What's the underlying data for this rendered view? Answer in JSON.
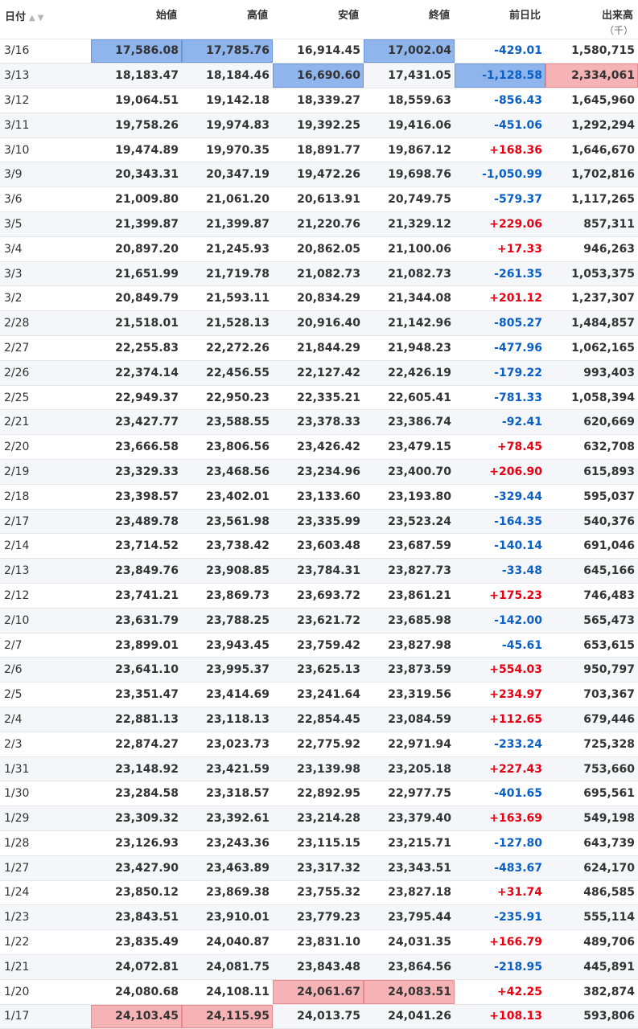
{
  "columns": {
    "date": "日付",
    "open": "始値",
    "high": "高値",
    "low": "安値",
    "close": "終値",
    "change": "前日比",
    "volume": "出来高",
    "volume_unit": "（千）"
  },
  "icons": {
    "sort": "sort-up-down-icon"
  },
  "colors": {
    "positive": "#e60012",
    "negative": "#0a5fc4",
    "highlight_blue": "#8fb5ec",
    "highlight_red": "#f5b3b5"
  },
  "rows": [
    {
      "date": "3/16",
      "open": "17,586.08",
      "high": "17,785.76",
      "low": "16,914.45",
      "close": "17,002.04",
      "change": "-429.01",
      "volume": "1,580,715",
      "hl": {
        "open": "blue",
        "high": "blue",
        "close": "blue"
      }
    },
    {
      "date": "3/13",
      "open": "18,183.47",
      "high": "18,184.46",
      "low": "16,690.60",
      "close": "17,431.05",
      "change": "-1,128.58",
      "volume": "2,334,061",
      "hl": {
        "low": "blue",
        "change": "blue",
        "volume": "red"
      }
    },
    {
      "date": "3/12",
      "open": "19,064.51",
      "high": "19,142.18",
      "low": "18,339.27",
      "close": "18,559.63",
      "change": "-856.43",
      "volume": "1,645,960"
    },
    {
      "date": "3/11",
      "open": "19,758.26",
      "high": "19,974.83",
      "low": "19,392.25",
      "close": "19,416.06",
      "change": "-451.06",
      "volume": "1,292,294"
    },
    {
      "date": "3/10",
      "open": "19,474.89",
      "high": "19,970.35",
      "low": "18,891.77",
      "close": "19,867.12",
      "change": "+168.36",
      "volume": "1,646,670"
    },
    {
      "date": "3/9",
      "open": "20,343.31",
      "high": "20,347.19",
      "low": "19,472.26",
      "close": "19,698.76",
      "change": "-1,050.99",
      "volume": "1,702,816"
    },
    {
      "date": "3/6",
      "open": "21,009.80",
      "high": "21,061.20",
      "low": "20,613.91",
      "close": "20,749.75",
      "change": "-579.37",
      "volume": "1,117,265"
    },
    {
      "date": "3/5",
      "open": "21,399.87",
      "high": "21,399.87",
      "low": "21,220.76",
      "close": "21,329.12",
      "change": "+229.06",
      "volume": "857,311"
    },
    {
      "date": "3/4",
      "open": "20,897.20",
      "high": "21,245.93",
      "low": "20,862.05",
      "close": "21,100.06",
      "change": "+17.33",
      "volume": "946,263"
    },
    {
      "date": "3/3",
      "open": "21,651.99",
      "high": "21,719.78",
      "low": "21,082.73",
      "close": "21,082.73",
      "change": "-261.35",
      "volume": "1,053,375"
    },
    {
      "date": "3/2",
      "open": "20,849.79",
      "high": "21,593.11",
      "low": "20,834.29",
      "close": "21,344.08",
      "change": "+201.12",
      "volume": "1,237,307"
    },
    {
      "date": "2/28",
      "open": "21,518.01",
      "high": "21,528.13",
      "low": "20,916.40",
      "close": "21,142.96",
      "change": "-805.27",
      "volume": "1,484,857"
    },
    {
      "date": "2/27",
      "open": "22,255.83",
      "high": "22,272.26",
      "low": "21,844.29",
      "close": "21,948.23",
      "change": "-477.96",
      "volume": "1,062,165"
    },
    {
      "date": "2/26",
      "open": "22,374.14",
      "high": "22,456.55",
      "low": "22,127.42",
      "close": "22,426.19",
      "change": "-179.22",
      "volume": "993,403"
    },
    {
      "date": "2/25",
      "open": "22,949.37",
      "high": "22,950.23",
      "low": "22,335.21",
      "close": "22,605.41",
      "change": "-781.33",
      "volume": "1,058,394"
    },
    {
      "date": "2/21",
      "open": "23,427.77",
      "high": "23,588.55",
      "low": "23,378.33",
      "close": "23,386.74",
      "change": "-92.41",
      "volume": "620,669"
    },
    {
      "date": "2/20",
      "open": "23,666.58",
      "high": "23,806.56",
      "low": "23,426.42",
      "close": "23,479.15",
      "change": "+78.45",
      "volume": "632,708"
    },
    {
      "date": "2/19",
      "open": "23,329.33",
      "high": "23,468.56",
      "low": "23,234.96",
      "close": "23,400.70",
      "change": "+206.90",
      "volume": "615,893"
    },
    {
      "date": "2/18",
      "open": "23,398.57",
      "high": "23,402.01",
      "low": "23,133.60",
      "close": "23,193.80",
      "change": "-329.44",
      "volume": "595,037"
    },
    {
      "date": "2/17",
      "open": "23,489.78",
      "high": "23,561.98",
      "low": "23,335.99",
      "close": "23,523.24",
      "change": "-164.35",
      "volume": "540,376"
    },
    {
      "date": "2/14",
      "open": "23,714.52",
      "high": "23,738.42",
      "low": "23,603.48",
      "close": "23,687.59",
      "change": "-140.14",
      "volume": "691,046"
    },
    {
      "date": "2/13",
      "open": "23,849.76",
      "high": "23,908.85",
      "low": "23,784.31",
      "close": "23,827.73",
      "change": "-33.48",
      "volume": "645,166"
    },
    {
      "date": "2/12",
      "open": "23,741.21",
      "high": "23,869.73",
      "low": "23,693.72",
      "close": "23,861.21",
      "change": "+175.23",
      "volume": "746,483"
    },
    {
      "date": "2/10",
      "open": "23,631.79",
      "high": "23,788.25",
      "low": "23,621.72",
      "close": "23,685.98",
      "change": "-142.00",
      "volume": "565,473"
    },
    {
      "date": "2/7",
      "open": "23,899.01",
      "high": "23,943.45",
      "low": "23,759.42",
      "close": "23,827.98",
      "change": "-45.61",
      "volume": "653,615"
    },
    {
      "date": "2/6",
      "open": "23,641.10",
      "high": "23,995.37",
      "low": "23,625.13",
      "close": "23,873.59",
      "change": "+554.03",
      "volume": "950,797"
    },
    {
      "date": "2/5",
      "open": "23,351.47",
      "high": "23,414.69",
      "low": "23,241.64",
      "close": "23,319.56",
      "change": "+234.97",
      "volume": "703,367"
    },
    {
      "date": "2/4",
      "open": "22,881.13",
      "high": "23,118.13",
      "low": "22,854.45",
      "close": "23,084.59",
      "change": "+112.65",
      "volume": "679,446"
    },
    {
      "date": "2/3",
      "open": "22,874.27",
      "high": "23,023.73",
      "low": "22,775.92",
      "close": "22,971.94",
      "change": "-233.24",
      "volume": "725,328"
    },
    {
      "date": "1/31",
      "open": "23,148.92",
      "high": "23,421.59",
      "low": "23,139.98",
      "close": "23,205.18",
      "change": "+227.43",
      "volume": "753,660"
    },
    {
      "date": "1/30",
      "open": "23,284.58",
      "high": "23,318.57",
      "low": "22,892.95",
      "close": "22,977.75",
      "change": "-401.65",
      "volume": "695,561"
    },
    {
      "date": "1/29",
      "open": "23,309.32",
      "high": "23,392.61",
      "low": "23,214.28",
      "close": "23,379.40",
      "change": "+163.69",
      "volume": "549,198"
    },
    {
      "date": "1/28",
      "open": "23,126.93",
      "high": "23,243.36",
      "low": "23,115.15",
      "close": "23,215.71",
      "change": "-127.80",
      "volume": "643,739"
    },
    {
      "date": "1/27",
      "open": "23,427.90",
      "high": "23,463.89",
      "low": "23,317.32",
      "close": "23,343.51",
      "change": "-483.67",
      "volume": "624,170"
    },
    {
      "date": "1/24",
      "open": "23,850.12",
      "high": "23,869.38",
      "low": "23,755.32",
      "close": "23,827.18",
      "change": "+31.74",
      "volume": "486,585"
    },
    {
      "date": "1/23",
      "open": "23,843.51",
      "high": "23,910.01",
      "low": "23,779.23",
      "close": "23,795.44",
      "change": "-235.91",
      "volume": "555,114"
    },
    {
      "date": "1/22",
      "open": "23,835.49",
      "high": "24,040.87",
      "low": "23,831.10",
      "close": "24,031.35",
      "change": "+166.79",
      "volume": "489,706"
    },
    {
      "date": "1/21",
      "open": "24,072.81",
      "high": "24,081.75",
      "low": "23,843.48",
      "close": "23,864.56",
      "change": "-218.95",
      "volume": "445,891"
    },
    {
      "date": "1/20",
      "open": "24,080.68",
      "high": "24,108.11",
      "low": "24,061.67",
      "close": "24,083.51",
      "change": "+42.25",
      "volume": "382,874",
      "hl": {
        "low": "red",
        "close": "red"
      }
    },
    {
      "date": "1/17",
      "open": "24,103.45",
      "high": "24,115.95",
      "low": "24,013.75",
      "close": "24,041.26",
      "change": "+108.13",
      "volume": "593,806",
      "hl": {
        "open": "red",
        "high": "red"
      }
    }
  ]
}
